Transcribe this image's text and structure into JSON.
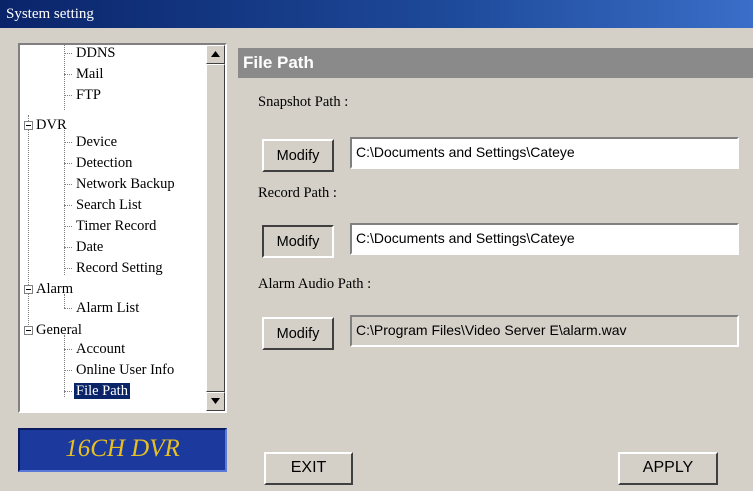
{
  "window": {
    "title": "System setting"
  },
  "tree": {
    "items": [
      {
        "label": "DDNS"
      },
      {
        "label": "Mail"
      },
      {
        "label": "FTP"
      },
      {
        "label": "DVR"
      },
      {
        "label": "Device"
      },
      {
        "label": "Detection"
      },
      {
        "label": "Network Backup"
      },
      {
        "label": "Search List"
      },
      {
        "label": "Timer Record"
      },
      {
        "label": "Date"
      },
      {
        "label": "Record Setting"
      },
      {
        "label": "Alarm"
      },
      {
        "label": "Alarm List"
      },
      {
        "label": "General"
      },
      {
        "label": "Account"
      },
      {
        "label": "Online User Info"
      },
      {
        "label": "File Path"
      }
    ],
    "selected": "File Path"
  },
  "logo": {
    "text": "16CH DVR"
  },
  "panel": {
    "title": "File Path",
    "snapshot": {
      "label": "Snapshot Path :",
      "button": "Modify",
      "value": "C:\\Documents and Settings\\Cateye"
    },
    "record": {
      "label": "Record Path :",
      "button": "Modify",
      "value": "C:\\Documents and Settings\\Cateye"
    },
    "alarm_audio": {
      "label": "Alarm Audio Path :",
      "button": "Modify",
      "value": "C:\\Program Files\\Video Server E\\alarm.wav"
    }
  },
  "footer": {
    "exit": "EXIT",
    "apply": "APPLY"
  }
}
